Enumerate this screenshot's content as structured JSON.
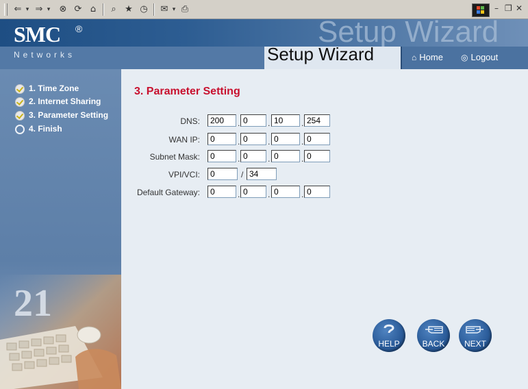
{
  "browser": {
    "toolbar_icons": [
      "back-arrow-icon",
      "forward-arrow-icon",
      "stop-icon",
      "refresh-icon",
      "home-icon",
      "search-icon",
      "favorites-icon",
      "history-icon",
      "mail-icon",
      "print-icon"
    ],
    "window_controls": [
      "minimize",
      "restore",
      "close"
    ]
  },
  "header": {
    "logo": "SMC",
    "logo_mark": "®",
    "logo_sub": "Networks",
    "ghost_title": "Setup Wizard",
    "title": "Setup Wizard",
    "nav": {
      "home": "Home",
      "logout": "Logout"
    }
  },
  "sidebar": {
    "steps": [
      {
        "label": "1. Time Zone",
        "status": "done"
      },
      {
        "label": "2. Internet Sharing",
        "status": "done"
      },
      {
        "label": "3. Parameter Setting",
        "status": "done"
      },
      {
        "label": "4. Finish",
        "status": "pending"
      }
    ],
    "decoration_text": "21"
  },
  "content": {
    "section_title": "3. Parameter Setting",
    "fields": {
      "dns": {
        "label": "DNS:",
        "values": [
          "200",
          "0",
          "10",
          "254"
        ]
      },
      "wan_ip": {
        "label": "WAN IP:",
        "values": [
          "0",
          "0",
          "0",
          "0"
        ]
      },
      "subnet_mask": {
        "label": "Subnet Mask:",
        "values": [
          "0",
          "0",
          "0",
          "0"
        ]
      },
      "vpi_vci": {
        "label": "VPI/VCI:",
        "vpi": "0",
        "separator": "/",
        "vci": "34"
      },
      "default_gateway": {
        "label": "Default Gateway:",
        "values": [
          "0",
          "0",
          "0",
          "0"
        ]
      }
    },
    "dot": ".",
    "buttons": {
      "help": "HELP",
      "back": "BACK",
      "next": "NEXT"
    }
  },
  "colors": {
    "title_red": "#c8102e",
    "brand_blue": "#2d5d92",
    "content_bg": "#e7edf3"
  }
}
